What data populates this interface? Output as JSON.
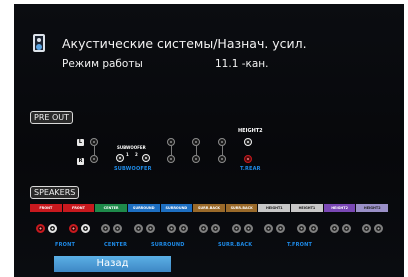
{
  "header": {
    "title": "Акустические системы/Назнач. усил.",
    "mode_label": "Режим работы",
    "mode_value": "11.1 -кан."
  },
  "pre_out": {
    "label": "PRE OUT",
    "left_tag": "L",
    "right_tag": "R",
    "subwoofer_label": "SUBWOOFER",
    "sub1": "1",
    "sub2": "2",
    "subwoofer_bottom": "SUBWOOFER",
    "height2": "HEIGHT2",
    "trear": "T.REAR"
  },
  "speakers": {
    "label": "SPEAKERS",
    "bands": [
      "FRONT",
      "FRONT",
      "CENTER",
      "SURROUND",
      "SURROUND",
      "SURR.BACK",
      "SURR.BACK",
      "HEIGHT1",
      "HEIGHT1",
      "HEIGHT2",
      "HEIGHT2"
    ],
    "band_colors": [
      "#c8191e",
      "#c8191e",
      "#1e8a4a",
      "#1d6fc2",
      "#1d6fc2",
      "#9a6a2a",
      "#9a6a2a",
      "#c8c8c8",
      "#c8c8c8",
      "#7a48b5",
      "#9a90c8"
    ],
    "group_labels": [
      "FRONT",
      "CENTER",
      "SURROUND",
      "SURR.BACK",
      "T.FRONT"
    ]
  },
  "footer": {
    "back_label": "Назад"
  },
  "colors": {
    "accent_blue": "#1e8be8",
    "background": "#0a0c10"
  }
}
